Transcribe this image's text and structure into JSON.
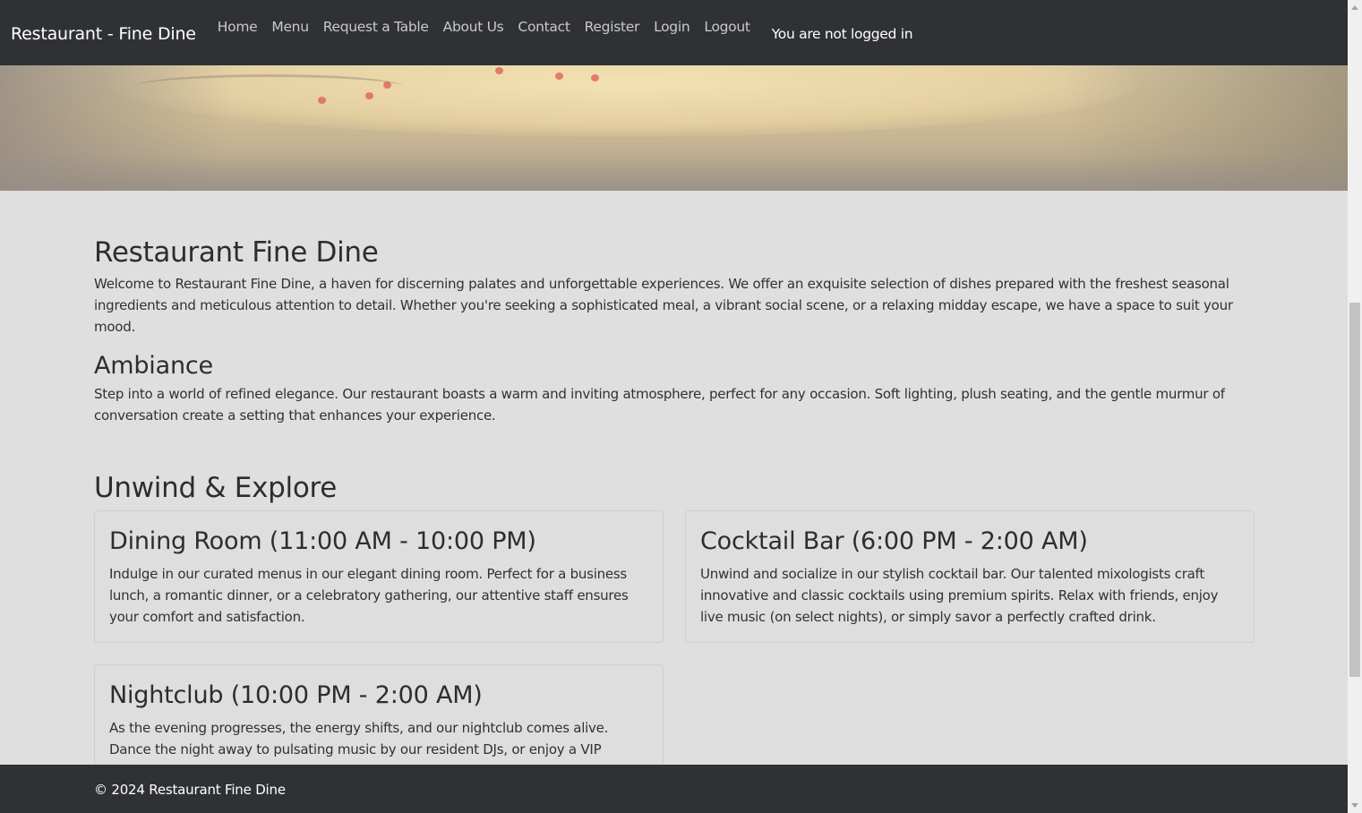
{
  "navbar": {
    "brand": "Restaurant - Fine Dine",
    "items": [
      {
        "label": "Home"
      },
      {
        "label": "Menu"
      },
      {
        "label": "Request a Table"
      },
      {
        "label": "About Us"
      },
      {
        "label": "Contact"
      },
      {
        "label": "Register"
      },
      {
        "label": "Login"
      },
      {
        "label": "Logout"
      }
    ],
    "status": "You are not logged in"
  },
  "main": {
    "title": "Restaurant Fine Dine",
    "intro": "Welcome to Restaurant Fine Dine, a haven for discerning palates and unforgettable experiences. We offer an exquisite selection of dishes prepared with the freshest seasonal ingredients and meticulous attention to detail. Whether you're seeking a sophisticated meal, a vibrant social scene, or a relaxing midday escape, we have a space to suit your mood.",
    "ambiance": {
      "heading": "Ambiance",
      "text": "Step into a world of refined elegance. Our restaurant boasts a warm and inviting atmosphere, perfect for any occasion. Soft lighting, plush seating, and the gentle murmur of conversation create a setting that enhances your experience."
    },
    "explore_heading": "Unwind & Explore",
    "cards": [
      {
        "title": "Dining Room (11:00 AM - 10:00 PM)",
        "text": "Indulge in our curated menus in our elegant dining room. Perfect for a business lunch, a romantic dinner, or a celebratory gathering, our attentive staff ensures your comfort and satisfaction."
      },
      {
        "title": "Cocktail Bar (6:00 PM - 2:00 AM)",
        "text": "Unwind and socialize in our stylish cocktail bar. Our talented mixologists craft innovative and classic cocktails using premium spirits. Relax with friends, enjoy live music (on select nights), or simply savor a perfectly crafted drink."
      },
      {
        "title": "Nightclub (10:00 PM - 2:00 AM)",
        "text": "As the evening progresses, the energy shifts, and our nightclub comes alive. Dance the night away to pulsating music by our resident DJs, or enjoy a VIP experience in one of our exclusive booths."
      }
    ]
  },
  "footer": {
    "text": "© 2024 Restaurant Fine Dine"
  }
}
